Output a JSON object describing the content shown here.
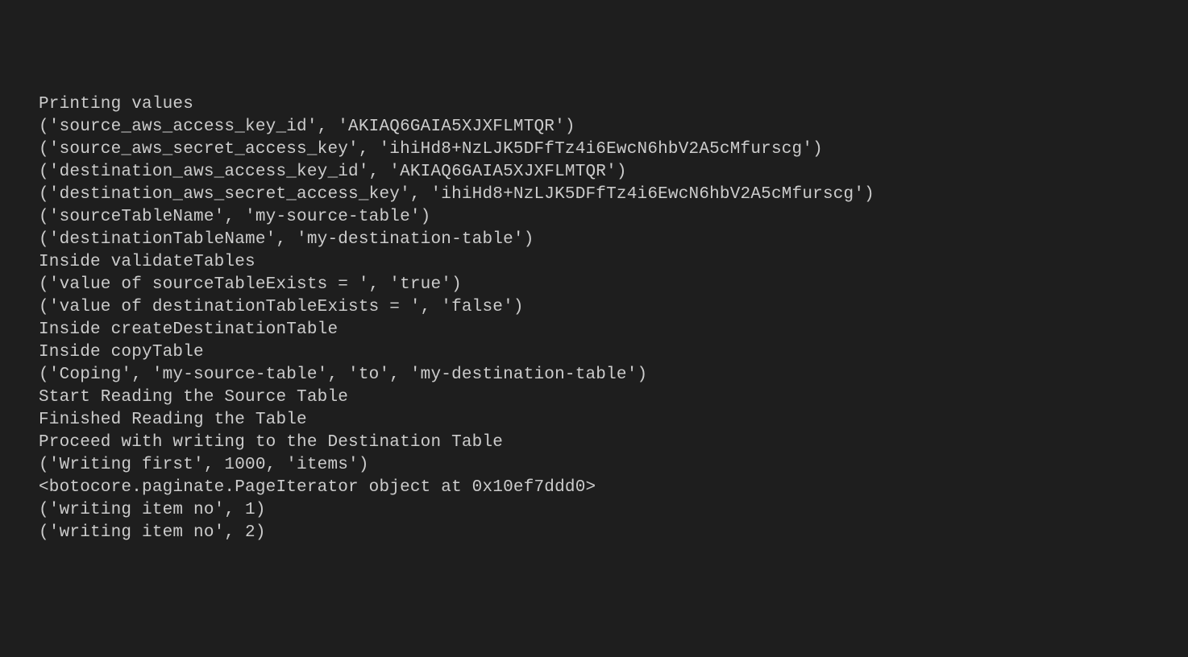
{
  "terminal": {
    "lines": [
      "Printing values",
      "('source_aws_access_key_id', 'AKIAQ6GAIA5XJXFLMTQR')",
      "('source_aws_secret_access_key', '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')",
      "('destination_aws_access_key_id', 'AKIAQ6GAIA5XJXFLMTQR')",
      "('destination_aws_secret_access_key', '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')",
      "('sourceTableName', 'my-source-table')",
      "('destinationTableName', 'my-destination-table')",
      "Inside validateTables",
      "('value of sourceTableExists = ', 'true')",
      "('value of destinationTableExists = ', 'false')",
      "Inside createDestinationTable",
      "Inside copyTable",
      "('Coping', 'my-source-table', 'to', 'my-destination-table')",
      "Start Reading the Source Table",
      "Finished Reading the Table",
      "Proceed with writing to the Destination Table",
      "('Writing first', 1000, 'items')",
      "<botocore.paginate.PageIterator object at 0x10ef7ddd0>",
      "('writing item no', 1)",
      "('writing item no', 2)"
    ]
  }
}
